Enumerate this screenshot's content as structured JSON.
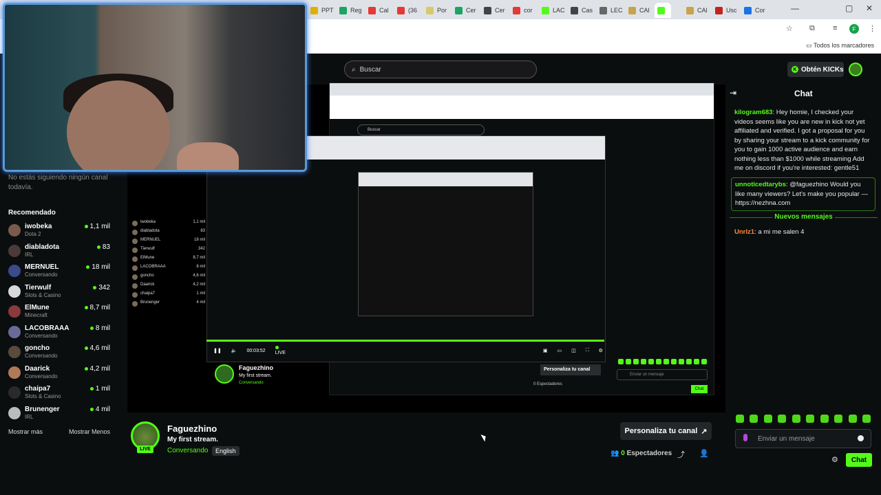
{
  "browser": {
    "tabs": [
      {
        "label": "PPT",
        "color": "#e0b000"
      },
      {
        "label": "Reg",
        "color": "#1ea362"
      },
      {
        "label": "Cal",
        "color": "#e53935"
      },
      {
        "label": "(36",
        "color": "#e53935"
      },
      {
        "label": "Por",
        "color": "#d7c96a"
      },
      {
        "label": "Cer",
        "color": "#1ea362"
      },
      {
        "label": "Cer",
        "color": "#444"
      },
      {
        "label": "cor",
        "color": "#e53935"
      },
      {
        "label": "LAC",
        "color": "#53fc18"
      },
      {
        "label": "Cas",
        "color": "#444"
      },
      {
        "label": "LEC",
        "color": "#666"
      },
      {
        "label": "CAl",
        "color": "#c8a34a"
      },
      {
        "label": "",
        "color": "#53fc18"
      },
      {
        "label": "CAl",
        "color": "#c8a34a"
      },
      {
        "label": "Usc",
        "color": "#c5221f"
      },
      {
        "label": "Cor",
        "color": "#1a73e8"
      }
    ],
    "bookmarks_label": "Todos los marcadores",
    "profile_initial": "F"
  },
  "header": {
    "search_placeholder": "Buscar",
    "kicks_button": "Obtén KICKs"
  },
  "sidebar": {
    "follow_note": "No estás siguiendo ningún canal todavía.",
    "recommended_title": "Recomendado",
    "items": [
      {
        "name": "iwobeka",
        "category": "Dota 2",
        "viewers": "1,1 mil",
        "avatar": "#7a5a4a"
      },
      {
        "name": "diabladota",
        "category": "IRL",
        "viewers": "83",
        "avatar": "#4a3a3a"
      },
      {
        "name": "MERNUEL",
        "category": "Conversando",
        "viewers": "18 mil",
        "avatar": "#3a4a8a"
      },
      {
        "name": "Tierwulf",
        "category": "Slots & Casino",
        "viewers": "342",
        "avatar": "#d9d9d9"
      },
      {
        "name": "ElMune",
        "category": "Minecraft",
        "viewers": "8,7 mil",
        "avatar": "#8a3a3a"
      },
      {
        "name": "LACOBRAAA",
        "category": "Conversando",
        "viewers": "8 mil",
        "avatar": "#6a6a9a"
      },
      {
        "name": "goncho",
        "category": "Conversando",
        "viewers": "4,6 mil",
        "avatar": "#5a4a3a"
      },
      {
        "name": "Daarick",
        "category": "Conversando",
        "viewers": "4,2 mil",
        "avatar": "#b07a5a"
      },
      {
        "name": "chaipa7",
        "category": "Slots & Casino",
        "viewers": "1 mil",
        "avatar": "#2a2a2a"
      },
      {
        "name": "Brunenger",
        "category": "IRL",
        "viewers": "4 mil",
        "avatar": "#bcbcbc"
      }
    ],
    "show_more": "Mostrar más",
    "show_less": "Mostrar Menos"
  },
  "player": {
    "time": "00:03:52",
    "live_label": "LIVE"
  },
  "channel": {
    "name": "Faguezhino",
    "title": "My first stream.",
    "category": "Conversando",
    "language": "English",
    "live_badge": "LIVE",
    "customize_button": "Personaliza tu canal",
    "viewers_count": "0",
    "viewers_label": "Espectadores"
  },
  "chat": {
    "title": "Chat",
    "messages": [
      {
        "user": "kilogram683",
        "color": "#53fc18",
        "text": "Hey homie, I checked your videos seems like you are new in kick not yet affiliated and verified. I got a proposal for you by sharing your stream to a kick community for you to gain 1000 active audience and earn nothing less than $1000 while streaming Add me on discord if you're interested: gentle51"
      },
      {
        "user": "unnoticedtarybs",
        "color": "#53fc18",
        "text": "@faguezhino Would you like many viewers? Let's make you popular — https://nezhna.com"
      },
      {
        "user": "Unrlz1",
        "color": "#ff8a3d",
        "text": "a mi me salen 4"
      }
    ],
    "new_messages_label": "Nuevos mensajes",
    "input_placeholder": "Enviar un mensaje",
    "send_button": "Chat"
  }
}
